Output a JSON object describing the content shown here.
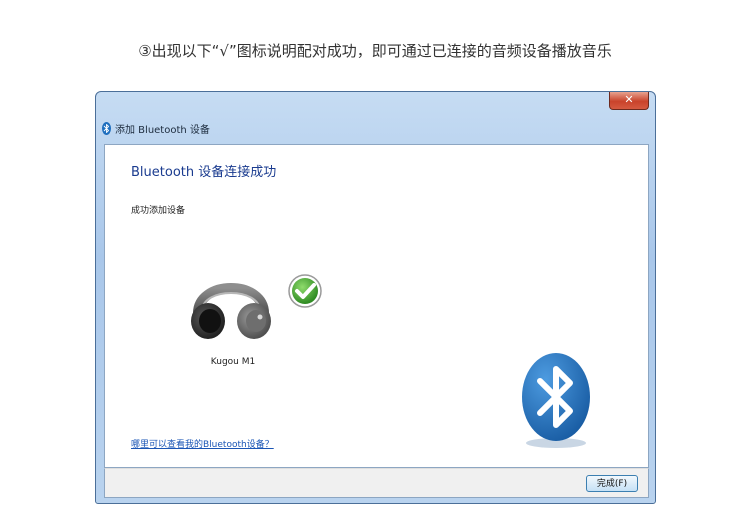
{
  "caption": "③出现以下“√”图标说明配对成功，即可通过已连接的音频设备播放音乐",
  "window": {
    "title": "添加 Bluetooth 设备",
    "close_glyph": "✕"
  },
  "content": {
    "heading": "Bluetooth 设备连接成功",
    "subtext": "成功添加设备",
    "device_name": "Kugou M1",
    "help_link": "哪里可以查看我的Bluetooth设备？"
  },
  "footer": {
    "finish_button": "完成(F)"
  },
  "colors": {
    "heading": "#1a3b8f",
    "link": "#1a55b5",
    "bluetooth_blue": "#1f6fbf",
    "check_green": "#3fa535"
  }
}
